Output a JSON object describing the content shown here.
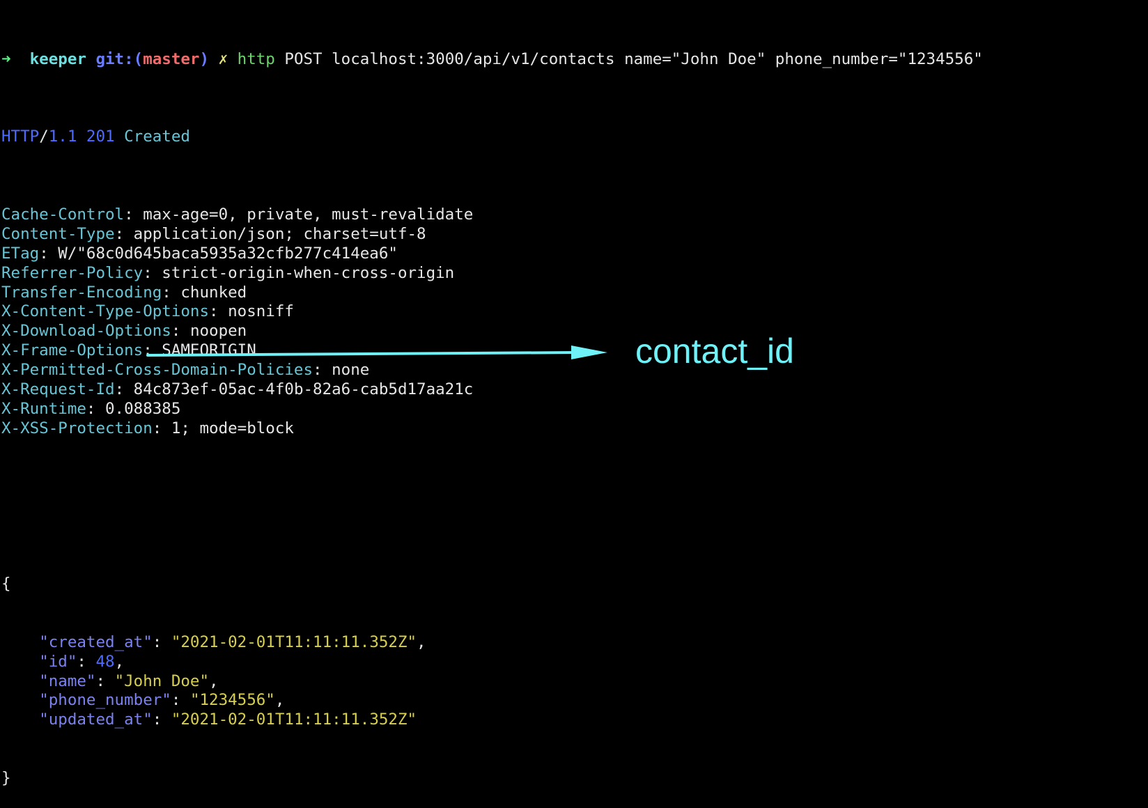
{
  "colors": {
    "background": "#000000",
    "prompt_arrow": "#5ff08a",
    "dir_name": "#6ce0e0",
    "git_label": "#6a7cff",
    "branch": "#f06c6c",
    "dirty_mark": "#e3e07a",
    "command": "#6dd36d",
    "header_key": "#68c5d6",
    "json_key": "#7b82f0",
    "json_string": "#d7cf4e",
    "json_number": "#4f6bff",
    "annotation": "#6ff1f8"
  },
  "prompt": {
    "arrow": "➜",
    "dir": "keeper",
    "git_prefix": "git:(",
    "branch": "master",
    "git_suffix": ")",
    "dirty": "✗",
    "command": "http",
    "args": "POST localhost:3000/api/v1/contacts name=\"John Doe\" phone_number=\"1234556\""
  },
  "status": {
    "proto": "HTTP",
    "slash": "/",
    "version": "1.1",
    "code": "201",
    "text": "Created"
  },
  "headers": [
    {
      "key": "Cache-Control",
      "value": "max-age=0, private, must-revalidate"
    },
    {
      "key": "Content-Type",
      "value": "application/json; charset=utf-8"
    },
    {
      "key": "ETag",
      "value": "W/\"68c0d645baca5935a32cfb277c414ea6\""
    },
    {
      "key": "Referrer-Policy",
      "value": "strict-origin-when-cross-origin"
    },
    {
      "key": "Transfer-Encoding",
      "value": "chunked"
    },
    {
      "key": "X-Content-Type-Options",
      "value": "nosniff"
    },
    {
      "key": "X-Download-Options",
      "value": "noopen"
    },
    {
      "key": "X-Frame-Options",
      "value": "SAMEORIGIN"
    },
    {
      "key": "X-Permitted-Cross-Domain-Policies",
      "value": "none"
    },
    {
      "key": "X-Request-Id",
      "value": "84c873ef-05ac-4f0b-82a6-cab5d17aa21c"
    },
    {
      "key": "X-Runtime",
      "value": "0.088385"
    },
    {
      "key": "X-XSS-Protection",
      "value": "1; mode=block"
    }
  ],
  "json_body": {
    "open": "{",
    "close": "}",
    "fields": [
      {
        "key": "\"created_at\"",
        "value": "\"2021-02-01T11:11:11.352Z\"",
        "type": "string",
        "comma": ","
      },
      {
        "key": "\"id\"",
        "value": "48",
        "type": "number",
        "comma": ","
      },
      {
        "key": "\"name\"",
        "value": "\"John Doe\"",
        "type": "string",
        "comma": ","
      },
      {
        "key": "\"phone_number\"",
        "value": "\"1234556\"",
        "type": "string",
        "comma": ","
      },
      {
        "key": "\"updated_at\"",
        "value": "\"2021-02-01T11:11:11.352Z\"",
        "type": "string",
        "comma": ""
      }
    ]
  },
  "annotation": {
    "label": "contact_id"
  }
}
